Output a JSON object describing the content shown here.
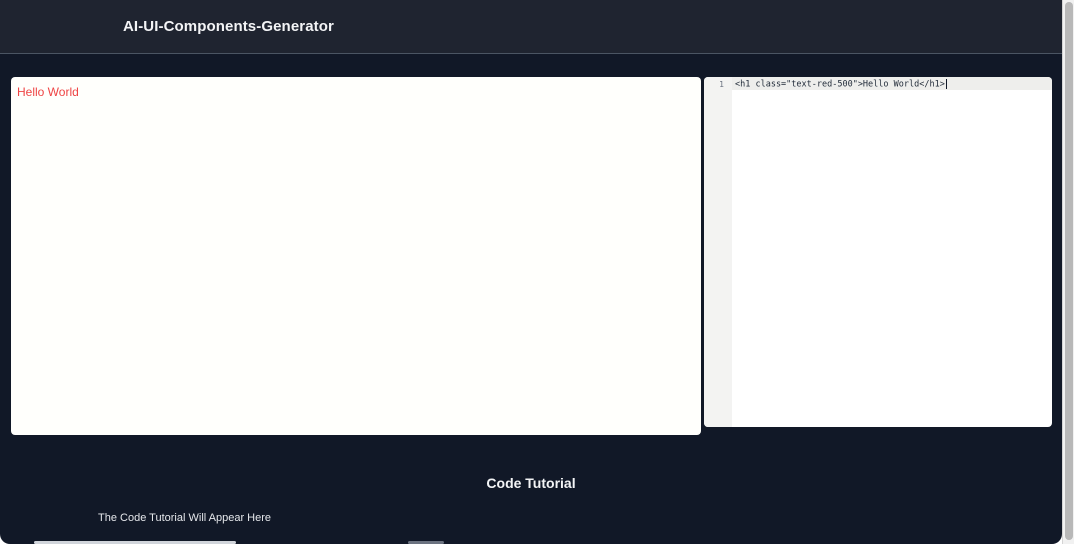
{
  "navbar": {
    "title": "AI-UI-Components-Generator"
  },
  "preview": {
    "heading_text": "Hello World",
    "heading_color": "#ef4444"
  },
  "editor": {
    "lines": [
      {
        "number": "1",
        "code": "<h1 class=\"text-red-500\">Hello World</h1>"
      }
    ]
  },
  "tutorial": {
    "title": "Code Tutorial",
    "body": "The Code Tutorial Will Appear Here"
  },
  "colors": {
    "background": "#111827",
    "navbar": "#1f2430",
    "panel": "#ffffff"
  }
}
